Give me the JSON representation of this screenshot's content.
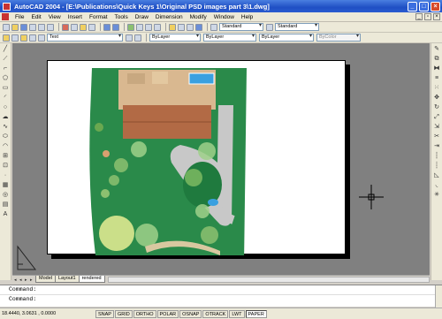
{
  "window": {
    "title": "AutoCAD 2004 - [E:\\Publications\\Quick Keys 1\\Original PSD images part 3\\1.dwg]"
  },
  "menu": [
    "File",
    "Edit",
    "View",
    "Insert",
    "Format",
    "Tools",
    "Draw",
    "Dimension",
    "Modify",
    "Window",
    "Help"
  ],
  "toolbar": {
    "text_style": "Standard",
    "dim_style": "Standard",
    "layer": "Text",
    "color": "ByLayer",
    "linetype": "ByLayer",
    "lineweight": "ByLayer",
    "plot_style": "ByColor"
  },
  "tabs": {
    "model": "Model",
    "layout1": "Layout1",
    "rendered": "rendered"
  },
  "command": {
    "line1": "Command:",
    "line2": "Command:"
  },
  "status": {
    "coords": "18.4440, 3.0631 , 0.0000",
    "buttons": [
      "SNAP",
      "GRID",
      "ORTHO",
      "POLAR",
      "OSNAP",
      "OTRACK",
      "LWT",
      "PAPER"
    ]
  },
  "colors": {
    "lawn": "#2a8a4a",
    "roof": "#b26a45",
    "pool": "#3aa0e0",
    "path": "#c8c8c8",
    "title_bar": "#1f4fc4"
  }
}
